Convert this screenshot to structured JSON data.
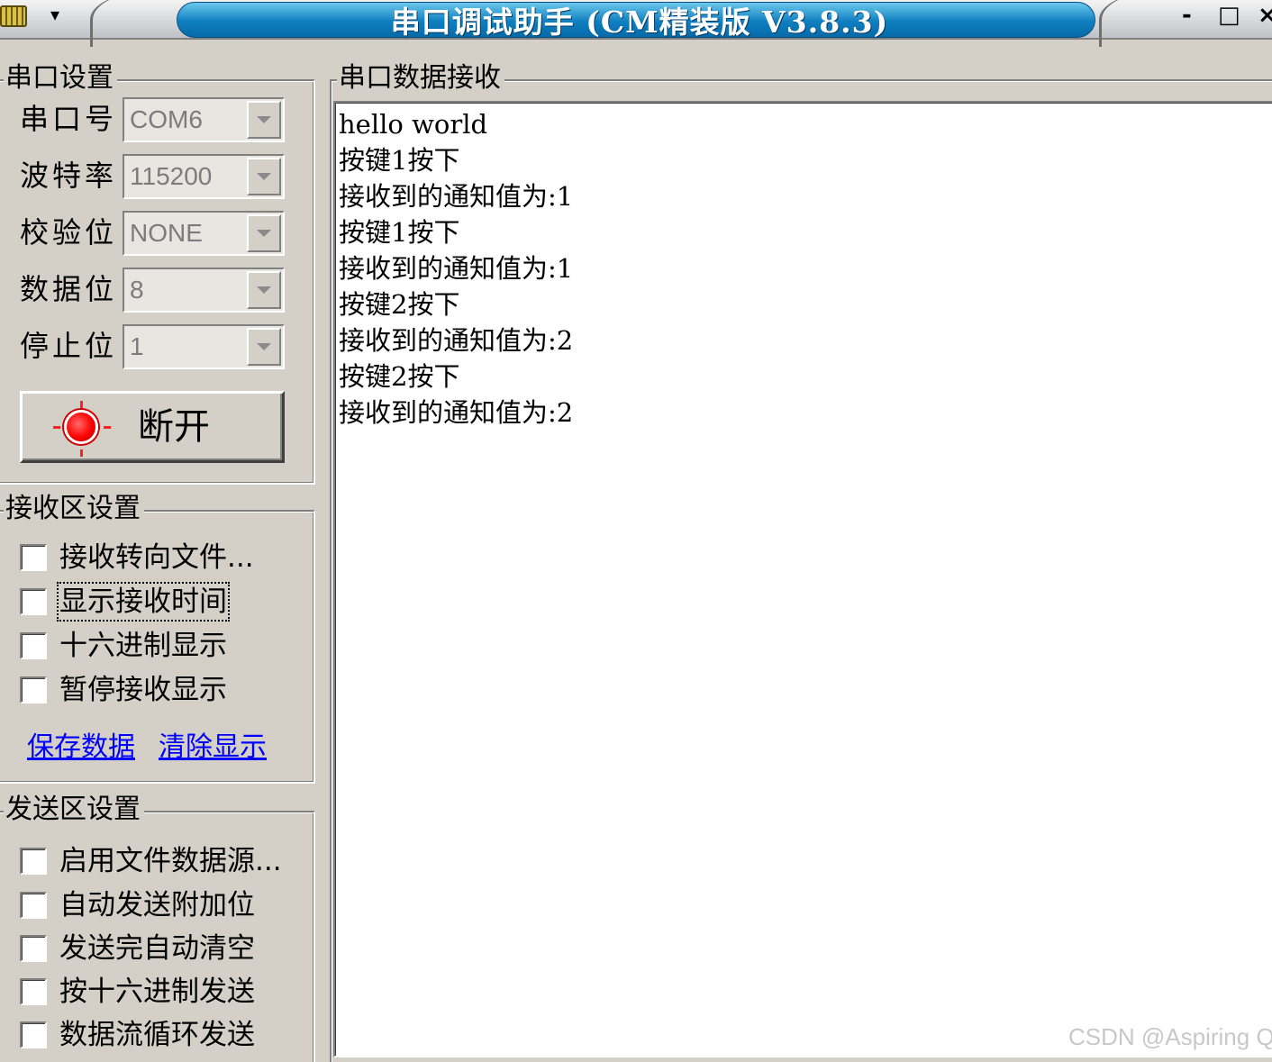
{
  "window": {
    "title": "串口调试助手 (CM精装版 V3.8.3)",
    "menu_arrow": "▾",
    "minimize": "-",
    "maximize": "□",
    "close": "×"
  },
  "serial_settings": {
    "legend": "串口设置",
    "port_label": "串口号",
    "port_value": "COM6",
    "baud_label": "波特率",
    "baud_value": "115200",
    "parity_label": "校验位",
    "parity_value": "NONE",
    "databits_label": "数据位",
    "databits_value": "8",
    "stopbits_label": "停止位",
    "stopbits_value": "1",
    "disconnect_label": "断开",
    "led_color": "#ff0000"
  },
  "receive_settings": {
    "legend": "接收区设置",
    "options": [
      "接收转向文件...",
      "显示接收时间",
      "十六进制显示",
      "暂停接收显示"
    ],
    "save_link": "保存数据",
    "clear_link": "清除显示"
  },
  "send_settings": {
    "legend": "发送区设置",
    "options": [
      "启用文件数据源...",
      "自动发送附加位",
      "发送完自动清空",
      "按十六进制发送",
      "数据流循环发送"
    ]
  },
  "data_receive": {
    "legend": "串口数据接收",
    "lines": [
      "hello world",
      "按键1按下",
      "接收到的通知值为:1",
      "按键1按下",
      "接收到的通知值为:1",
      "按键2按下",
      "接收到的通知值为:2",
      "按键2按下",
      "接收到的通知值为:2"
    ]
  },
  "watermark": "CSDN @Aspiring Q",
  "colors": {
    "title_bar": "#0f7fc0",
    "link": "#0000ff",
    "face": "#d4d0c8"
  }
}
